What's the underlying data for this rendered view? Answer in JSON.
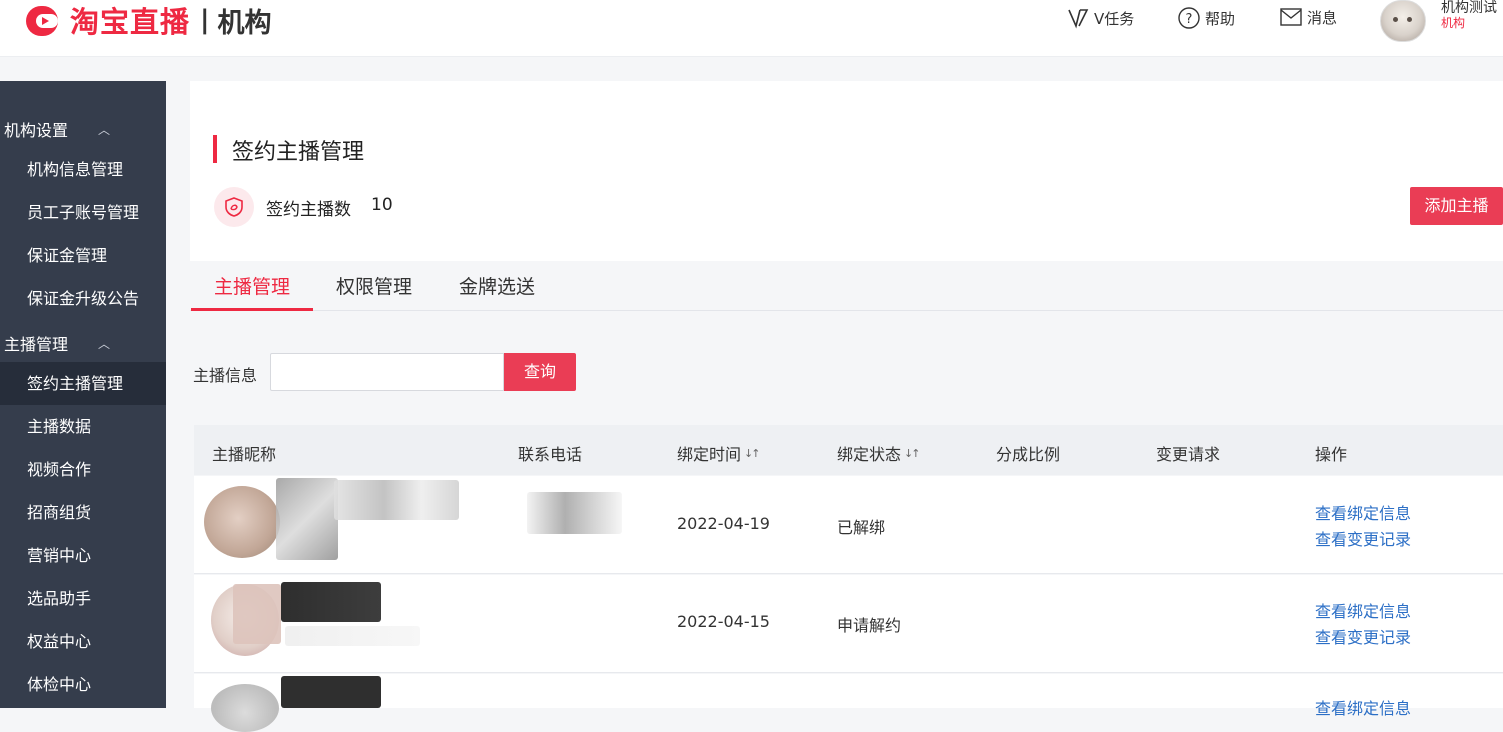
{
  "header": {
    "logo_text": "淘宝直播",
    "logo_sep": "|",
    "logo_sub": "机构",
    "nav": {
      "vtask": "V任务",
      "help": "帮助",
      "messages": "消息"
    },
    "user_name": "机构测试",
    "user_role": "机构"
  },
  "sidebar": {
    "groups": [
      {
        "label": "机构设置",
        "caret": "︿"
      },
      {
        "label": "主播管理",
        "caret": "︿"
      }
    ],
    "items": [
      {
        "label": "机构信息管理"
      },
      {
        "label": "员工子账号管理"
      },
      {
        "label": "保证金管理"
      },
      {
        "label": "保证金升级公告"
      },
      {
        "label": "签约主播管理"
      },
      {
        "label": "主播数据"
      },
      {
        "label": "视频合作"
      },
      {
        "label": "招商组货"
      },
      {
        "label": "营销中心"
      },
      {
        "label": "选品助手"
      },
      {
        "label": "权益中心"
      },
      {
        "label": "体检中心"
      }
    ]
  },
  "page": {
    "title": "签约主播管理",
    "count_label": "签约主播数",
    "count_value": "10",
    "add_button": "添加主播"
  },
  "tabs": [
    {
      "label": "主播管理"
    },
    {
      "label": "权限管理"
    },
    {
      "label": "金牌选送"
    }
  ],
  "search": {
    "label": "主播信息",
    "button": "查询",
    "value": ""
  },
  "table": {
    "headers": [
      "主播昵称",
      "联系电话",
      "绑定时间",
      "绑定状态",
      "分成比例",
      "变更请求",
      "操作"
    ],
    "sort_glyph": "↓↑",
    "rows": [
      {
        "bind_time": "2022-04-19",
        "status": "已解绑",
        "action1": "查看绑定信息",
        "action2": "查看变更记录"
      },
      {
        "bind_time": "2022-04-15",
        "status": "申请解约",
        "action1": "查看绑定信息",
        "action2": "查看变更记录"
      },
      {
        "bind_time": "",
        "status": "",
        "action1": "查看绑定信息",
        "action2": ""
      }
    ]
  },
  "colors": {
    "brand_red": "#ee2942",
    "button_red": "#ea3d55",
    "sidebar_bg": "#353d4c",
    "sidebar_active": "#262d3a",
    "link_blue": "#2c6fc6"
  }
}
